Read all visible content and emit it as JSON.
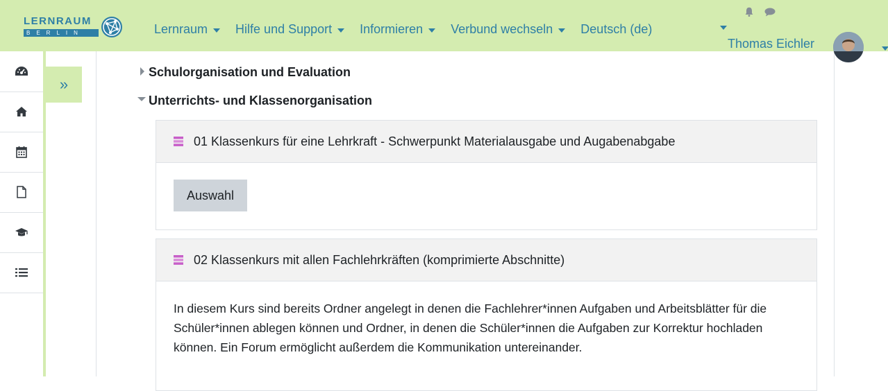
{
  "navbar": {
    "logo_top": "LERNRAUM",
    "logo_bottom": "BERLIN",
    "menu": [
      {
        "label": "Lernraum"
      },
      {
        "label": "Hilfe und Support"
      },
      {
        "label": "Informieren"
      },
      {
        "label": "Verbund wechseln"
      },
      {
        "label": "Deutsch (de)"
      }
    ],
    "user_name": "Thomas Eichler"
  },
  "rail": {
    "items": [
      {
        "icon": "dashboard-icon"
      },
      {
        "icon": "home-icon"
      },
      {
        "icon": "calendar-icon"
      },
      {
        "icon": "file-icon"
      },
      {
        "icon": "graduation-cap-icon"
      },
      {
        "icon": "list-icon"
      }
    ],
    "toggle_label": "»"
  },
  "categories": {
    "collapsed": "Schulorganisation und Evaluation",
    "expanded": "Unterrichts- und Klassenorganisation"
  },
  "courses": [
    {
      "title": "01 Klassenkurs für eine Lehrkraft - Schwerpunkt Materialausgabe und Augabenabgabe",
      "button": "Auswahl"
    },
    {
      "title": "02 Klassenkurs mit allen Fachlehrkräften (komprimierte Abschnitte)",
      "summary": "In diesem Kurs sind bereits Ordner angelegt in denen die Fachlehrer*innen Aufgaben und Arbeitsblätter für die Schüler*innen ablegen können und Ordner, in denen die Schüler*innen die Aufgaben zur Korrektur hochladen können. Ein Forum ermöglicht außerdem die Kommunikation untereinander."
    }
  ],
  "colors": {
    "navbar_bg": "#d4ecb0",
    "link": "#2e7fa6",
    "course_icon": "#c85fc9"
  }
}
